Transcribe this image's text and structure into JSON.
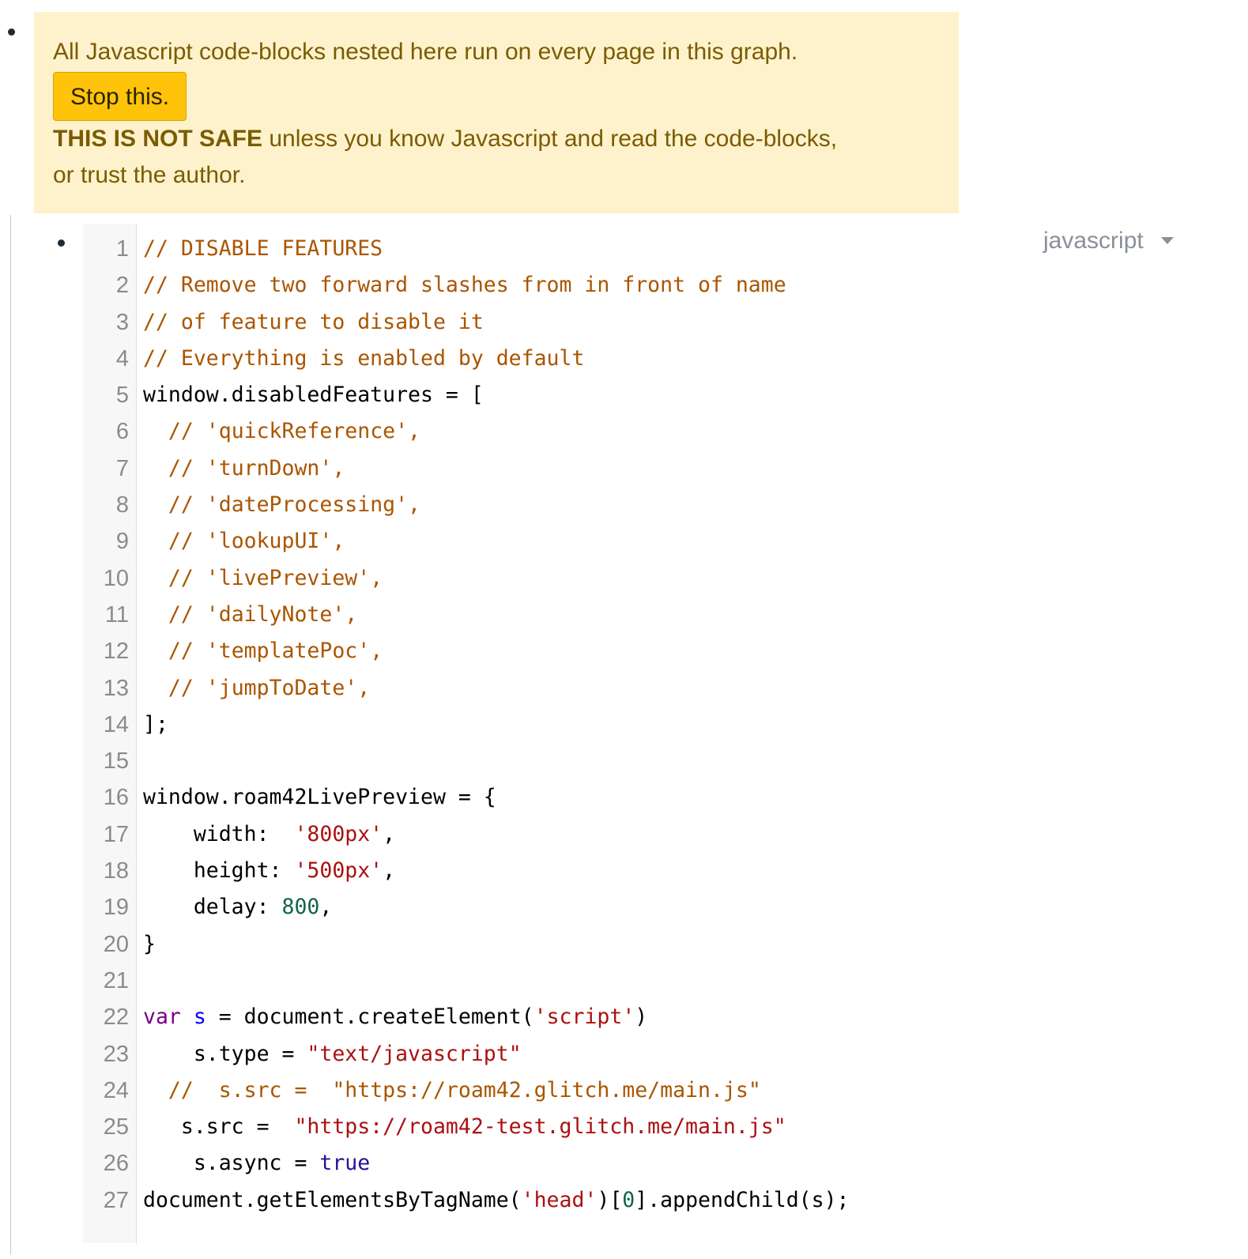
{
  "warning": {
    "line1": "All Javascript code-blocks nested here run on every page in this graph.",
    "stop_button": "Stop this.",
    "bold": "THIS IS NOT SAFE",
    "rest": " unless you know Javascript and read the code-blocks,",
    "line3": "or trust the author."
  },
  "code_block": {
    "language": "javascript",
    "lines": [
      {
        "n": "1",
        "tokens": [
          {
            "t": "// DISABLE FEATURES",
            "c": "comment"
          }
        ]
      },
      {
        "n": "2",
        "tokens": [
          {
            "t": "// Remove two forward slashes from in front of name",
            "c": "comment"
          }
        ]
      },
      {
        "n": "3",
        "tokens": [
          {
            "t": "// of feature to disable it",
            "c": "comment"
          }
        ]
      },
      {
        "n": "4",
        "tokens": [
          {
            "t": "// Everything is enabled by default",
            "c": "comment"
          }
        ]
      },
      {
        "n": "5",
        "tokens": [
          {
            "t": "window.disabledFeatures = [",
            "c": "plain"
          }
        ]
      },
      {
        "n": "6",
        "tokens": [
          {
            "t": "  ",
            "c": "plain"
          },
          {
            "t": "// 'quickReference',",
            "c": "comment"
          }
        ]
      },
      {
        "n": "7",
        "tokens": [
          {
            "t": "  ",
            "c": "plain"
          },
          {
            "t": "// 'turnDown',",
            "c": "comment"
          }
        ]
      },
      {
        "n": "8",
        "tokens": [
          {
            "t": "  ",
            "c": "plain"
          },
          {
            "t": "// 'dateProcessing',",
            "c": "comment"
          }
        ]
      },
      {
        "n": "9",
        "tokens": [
          {
            "t": "  ",
            "c": "plain"
          },
          {
            "t": "// 'lookupUI',",
            "c": "comment"
          }
        ]
      },
      {
        "n": "10",
        "tokens": [
          {
            "t": "  ",
            "c": "plain"
          },
          {
            "t": "// 'livePreview',",
            "c": "comment"
          }
        ]
      },
      {
        "n": "11",
        "tokens": [
          {
            "t": "  ",
            "c": "plain"
          },
          {
            "t": "// 'dailyNote',",
            "c": "comment"
          }
        ]
      },
      {
        "n": "12",
        "tokens": [
          {
            "t": "  ",
            "c": "plain"
          },
          {
            "t": "// 'templatePoc',",
            "c": "comment"
          }
        ]
      },
      {
        "n": "13",
        "tokens": [
          {
            "t": "  ",
            "c": "plain"
          },
          {
            "t": "// 'jumpToDate',",
            "c": "comment"
          }
        ]
      },
      {
        "n": "14",
        "tokens": [
          {
            "t": "];",
            "c": "plain"
          }
        ]
      },
      {
        "n": "15",
        "tokens": []
      },
      {
        "n": "16",
        "tokens": [
          {
            "t": "window.roam42LivePreview = {",
            "c": "plain"
          }
        ]
      },
      {
        "n": "17",
        "tokens": [
          {
            "t": "    width:  ",
            "c": "plain"
          },
          {
            "t": "'800px'",
            "c": "string"
          },
          {
            "t": ",",
            "c": "plain"
          }
        ]
      },
      {
        "n": "18",
        "tokens": [
          {
            "t": "    height: ",
            "c": "plain"
          },
          {
            "t": "'500px'",
            "c": "string"
          },
          {
            "t": ",",
            "c": "plain"
          }
        ]
      },
      {
        "n": "19",
        "tokens": [
          {
            "t": "    delay: ",
            "c": "plain"
          },
          {
            "t": "800",
            "c": "number"
          },
          {
            "t": ",",
            "c": "plain"
          }
        ]
      },
      {
        "n": "20",
        "tokens": [
          {
            "t": "}",
            "c": "plain"
          }
        ]
      },
      {
        "n": "21",
        "tokens": []
      },
      {
        "n": "22",
        "tokens": [
          {
            "t": "var",
            "c": "keyword"
          },
          {
            "t": " ",
            "c": "plain"
          },
          {
            "t": "s",
            "c": "def"
          },
          {
            "t": " = document.createElement(",
            "c": "plain"
          },
          {
            "t": "'script'",
            "c": "string"
          },
          {
            "t": ")",
            "c": "plain"
          }
        ]
      },
      {
        "n": "23",
        "tokens": [
          {
            "t": "    s.type = ",
            "c": "plain"
          },
          {
            "t": "\"text/javascript\"",
            "c": "string"
          }
        ]
      },
      {
        "n": "24",
        "tokens": [
          {
            "t": "  ",
            "c": "plain"
          },
          {
            "t": "//  s.src =  \"https://roam42.glitch.me/main.js\"",
            "c": "comment"
          }
        ]
      },
      {
        "n": "25",
        "tokens": [
          {
            "t": "   s.src =  ",
            "c": "plain"
          },
          {
            "t": "\"https://roam42-test.glitch.me/main.js\"",
            "c": "string"
          }
        ]
      },
      {
        "n": "26",
        "tokens": [
          {
            "t": "    s.async = ",
            "c": "plain"
          },
          {
            "t": "true",
            "c": "atom"
          }
        ]
      },
      {
        "n": "27",
        "tokens": [
          {
            "t": "document.getElementsByTagName(",
            "c": "plain"
          },
          {
            "t": "'head'",
            "c": "string"
          },
          {
            "t": ")[",
            "c": "plain"
          },
          {
            "t": "0",
            "c": "number"
          },
          {
            "t": "].appendChild(s);",
            "c": "plain"
          }
        ]
      }
    ]
  }
}
